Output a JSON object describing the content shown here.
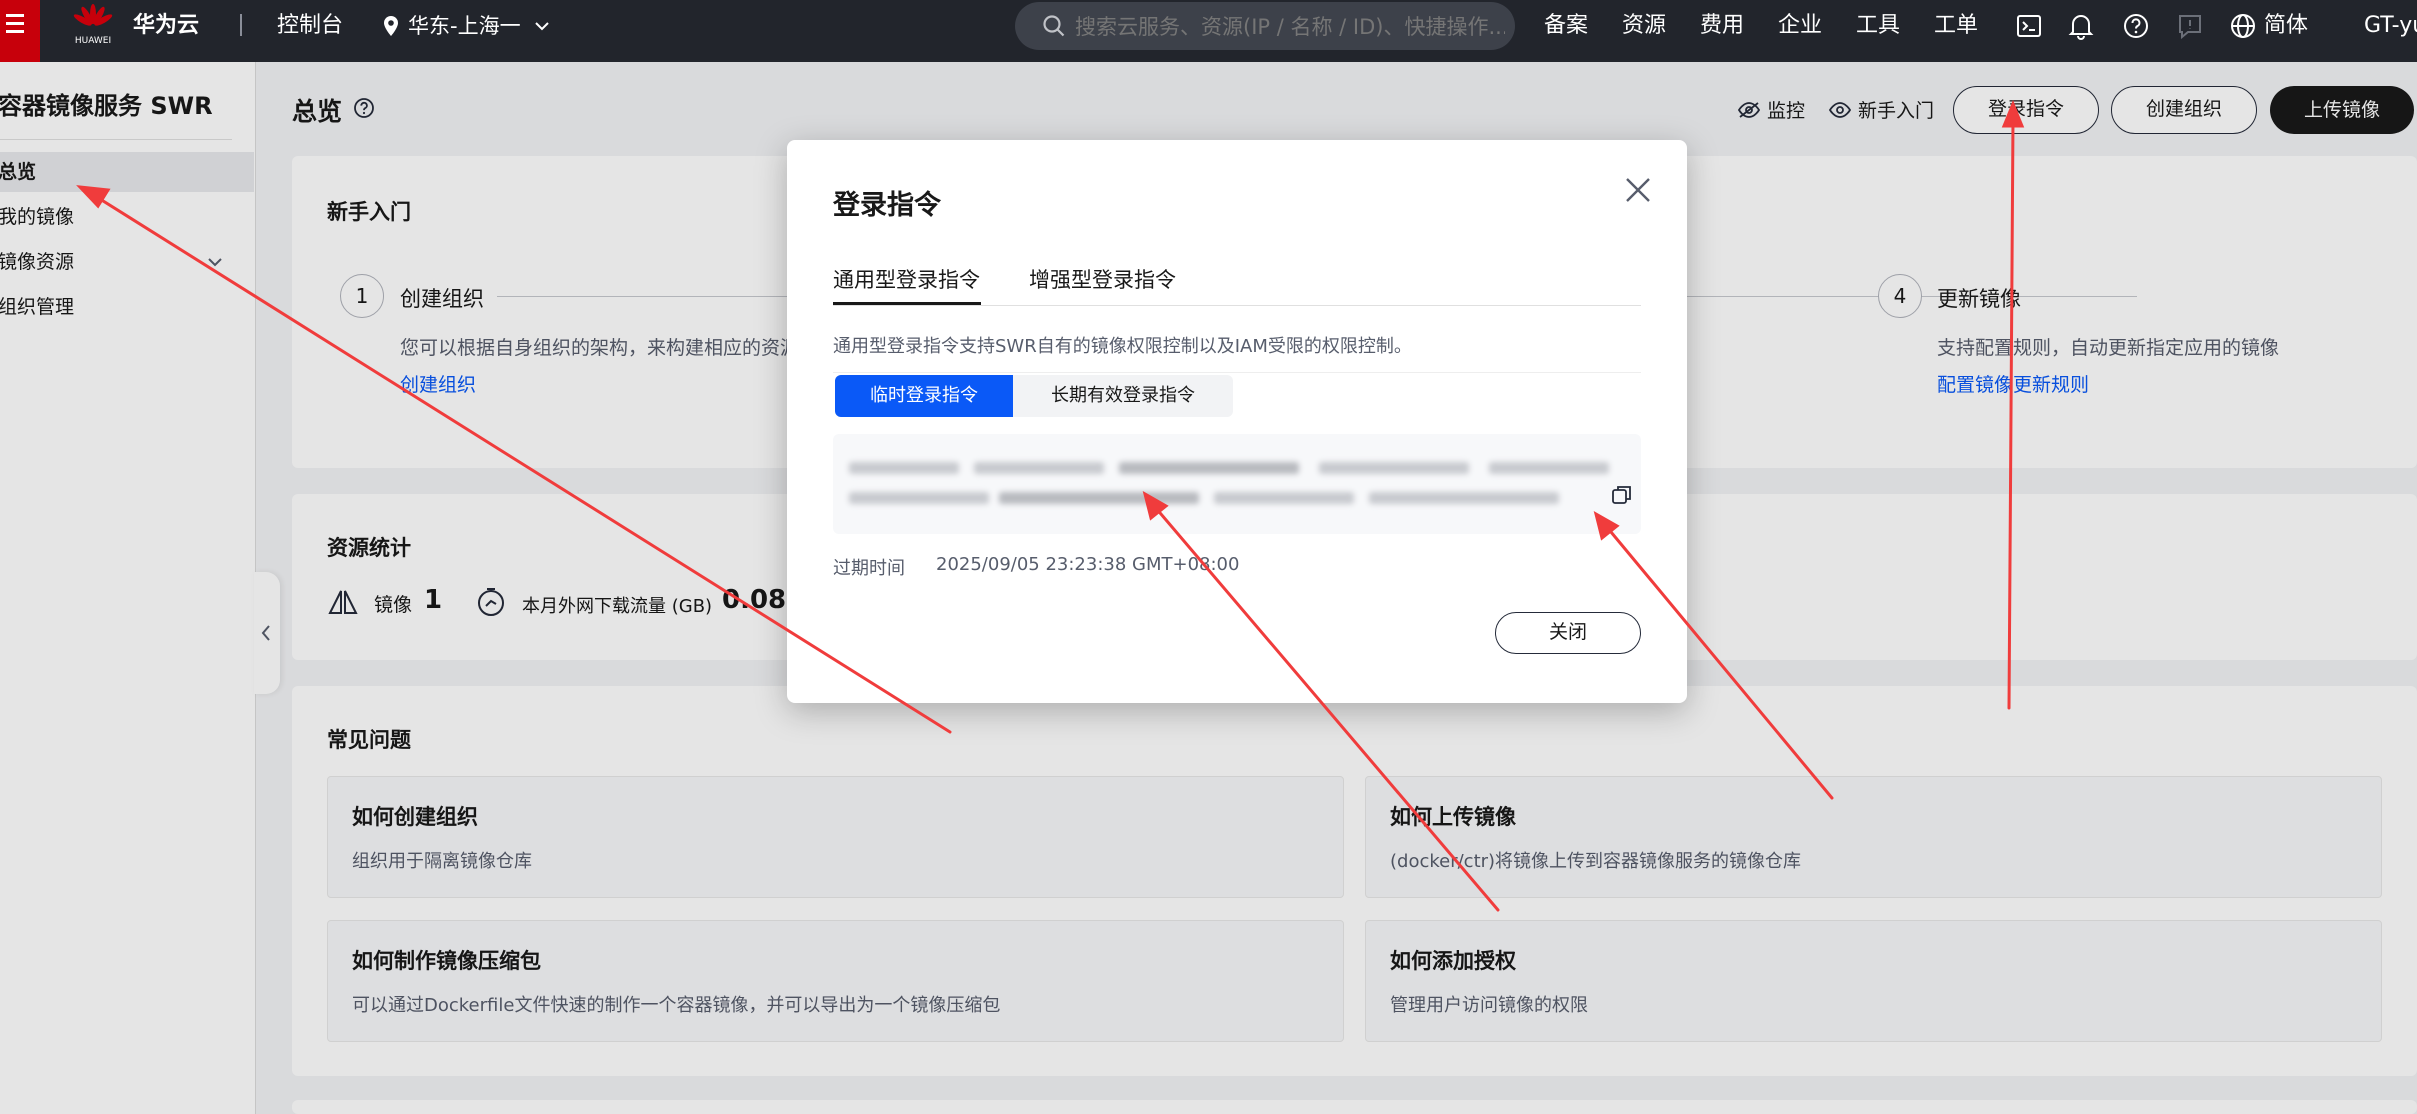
{
  "topbar": {
    "brand": "华为云",
    "logo_text": "HUAWEI",
    "console": "控制台",
    "region": "华东-上海一",
    "search_placeholder": "搜索云服务、资源(IP / 名称 / ID)、快捷操作...",
    "nav": [
      "备案",
      "资源",
      "费用",
      "企业",
      "工具",
      "工单"
    ],
    "language": "简体",
    "user": "GT-yu"
  },
  "sidebar": {
    "title": "容器镜像服务 SWR",
    "items": [
      {
        "label": "总览"
      },
      {
        "label": "我的镜像"
      },
      {
        "label": "镜像资源"
      },
      {
        "label": "组织管理"
      }
    ]
  },
  "header": {
    "title": "总览",
    "monitor": "监控",
    "guide": "新手入门",
    "login_cmd": "登录指令",
    "create_org": "创建组织",
    "upload": "上传镜像"
  },
  "getting_started": {
    "title": "新手入门",
    "step1": {
      "num": "1",
      "title": "创建组织",
      "desc": "您可以根据自身组织的架构，来构建相应的资源管",
      "link": "创建组织"
    },
    "step4": {
      "num": "4",
      "title": "更新镜像",
      "desc": "支持配置规则，自动更新指定应用的镜像",
      "link": "配置镜像更新规则"
    }
  },
  "stats": {
    "title": "资源统计",
    "images_label": "镜像",
    "images_value": "1",
    "traffic_label": "本月外网下载流量 (GB)",
    "traffic_value": "0.08"
  },
  "faq": {
    "title": "常见问题",
    "items": [
      {
        "title": "如何创建组织",
        "desc": "组织用于隔离镜像仓库"
      },
      {
        "title": "如何上传镜像",
        "desc": "(docker/ctr)将镜像上传到容器镜像服务的镜像仓库"
      },
      {
        "title": "如何制作镜像压缩包",
        "desc": "可以通过Dockerfile文件快速的制作一个容器镜像，并可以导出为一个镜像压缩包"
      },
      {
        "title": "如何添加授权",
        "desc": "管理用户访问镜像的权限"
      }
    ]
  },
  "modal": {
    "title": "登录指令",
    "tab_general": "通用型登录指令",
    "tab_enhanced": "增强型登录指令",
    "desc": "通用型登录指令支持SWR自有的镜像权限控制以及IAM受限的权限控制。",
    "sub_temp": "临时登录指令",
    "sub_long": "长期有效登录指令",
    "expire_label": "过期时间",
    "expire_value": "2025/09/05 23:23:38 GMT+08:00",
    "close": "关闭"
  },
  "colors": {
    "accent": "#0a59f7",
    "topbar": "#22252c",
    "brand_red": "#c7000b",
    "arrow": "#f03c3c"
  },
  "icons": [
    "menu-icon",
    "huawei-logo-icon",
    "location-icon",
    "chevron-down-icon",
    "search-icon",
    "terminal-icon",
    "bell-icon",
    "help-icon",
    "feedback-icon",
    "globe-icon",
    "eye-off-icon",
    "eye-icon",
    "copy-icon",
    "close-icon",
    "collapse-chevron-icon",
    "image-stack-icon",
    "gauge-icon"
  ]
}
